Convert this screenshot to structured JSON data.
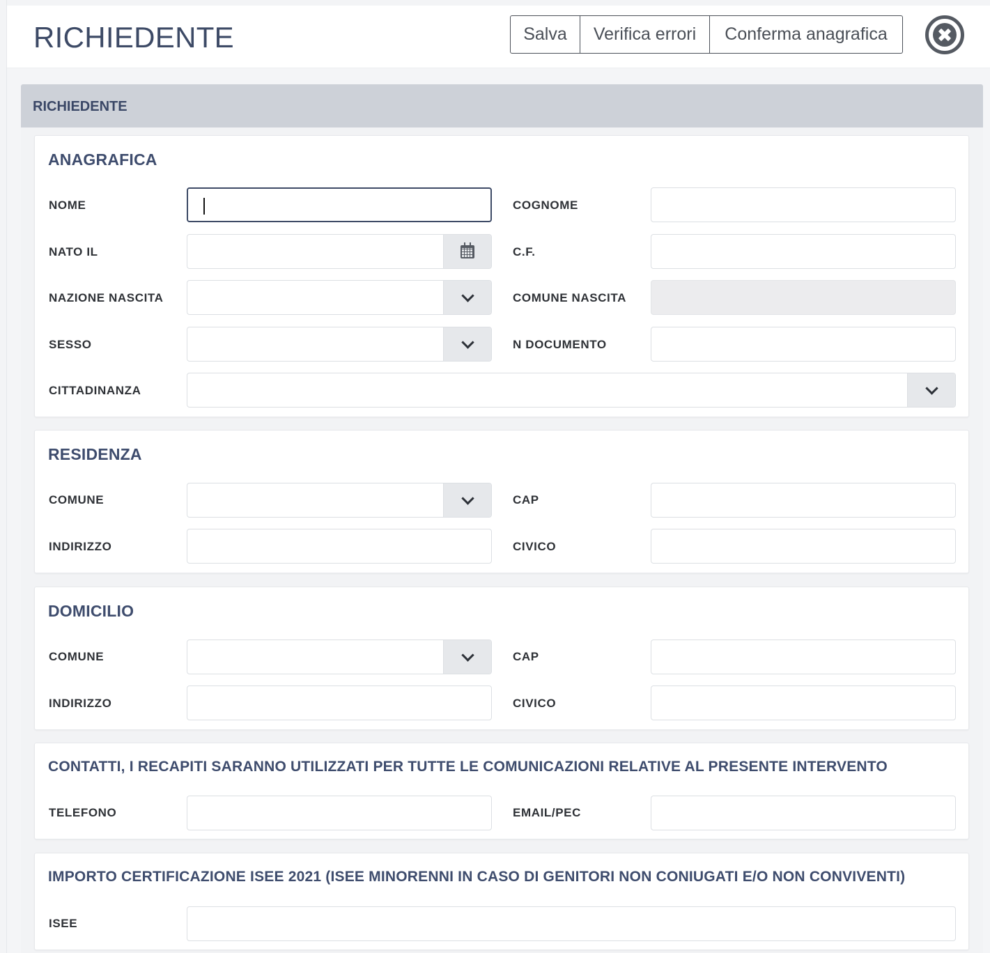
{
  "header": {
    "title": "RICHIEDENTE",
    "buttons": {
      "save": "Salva",
      "check_errors": "Verifica errori",
      "confirm": "Conferma anagrafica"
    }
  },
  "section": {
    "title": "RICHIEDENTE"
  },
  "anagrafica": {
    "title": "ANAGRAFICA",
    "labels": {
      "nome": "NOME",
      "cognome": "COGNOME",
      "nato_il": "NATO IL",
      "cf": "C.F.",
      "nazione_nascita": "NAZIONE NASCITA",
      "comune_nascita": "COMUNE NASCITA",
      "sesso": "SESSO",
      "n_documento": "N DOCUMENTO",
      "cittadinanza": "CITTADINANZA"
    },
    "values": {
      "nome": "",
      "cognome": "",
      "nato_il": "",
      "cf": "",
      "nazione_nascita": "",
      "comune_nascita": "",
      "sesso": "",
      "n_documento": "",
      "cittadinanza": ""
    }
  },
  "residenza": {
    "title": "RESIDENZA",
    "labels": {
      "comune": "COMUNE",
      "cap": "CAP",
      "indirizzo": "INDIRIZZO",
      "civico": "CIVICO"
    },
    "values": {
      "comune": "",
      "cap": "",
      "indirizzo": "",
      "civico": ""
    }
  },
  "domicilio": {
    "title": "DOMICILIO",
    "labels": {
      "comune": "COMUNE",
      "cap": "CAP",
      "indirizzo": "INDIRIZZO",
      "civico": "CIVICO"
    },
    "values": {
      "comune": "",
      "cap": "",
      "indirizzo": "",
      "civico": ""
    }
  },
  "contatti": {
    "title": "CONTATTI, I RECAPITI SARANNO UTILIZZATI PER TUTTE LE COMUNICAZIONI RELATIVE AL PRESENTE INTERVENTO",
    "labels": {
      "telefono": "TELEFONO",
      "email": "EMAIL/PEC"
    },
    "values": {
      "telefono": "",
      "email": ""
    }
  },
  "isee": {
    "title": "IMPORTO CERTIFICAZIONE ISEE 2021 (ISEE MINORENNI IN CASO DI GENITORI NON CONIUGATI E/O NON CONVIVENTI)",
    "labels": {
      "isee": "ISEE"
    },
    "values": {
      "isee": ""
    }
  },
  "colors": {
    "title_blue": "#3d4a66",
    "section_bar": "#cdd1d8",
    "addon_gray": "#e6e8eb"
  },
  "icons": {
    "close": "close-circle-icon",
    "calendar": "calendar-icon",
    "dropdown": "chevron-down-icon"
  }
}
